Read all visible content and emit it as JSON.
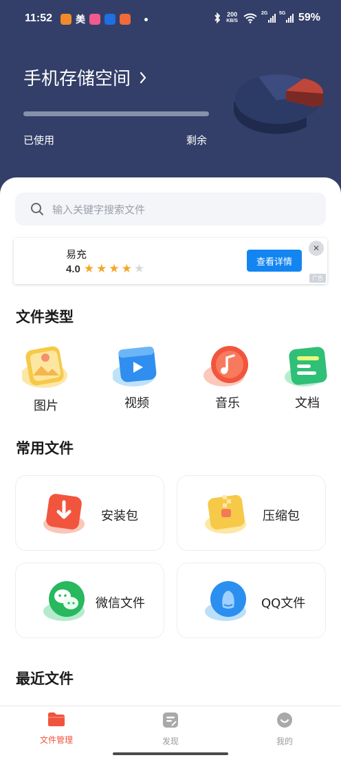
{
  "status_bar": {
    "time": "11:52",
    "mei_label": "美",
    "net_speed_value": "200",
    "net_speed_unit": "KB/S",
    "signal1_label": "2G",
    "signal2_label": "5G",
    "battery": "59%"
  },
  "storage": {
    "title": "手机存储空间",
    "used_label": "已使用",
    "free_label": "剩余",
    "used_fraction": 0.0
  },
  "search": {
    "placeholder": "输入关键字搜索文件"
  },
  "ad": {
    "app_name": "易充",
    "rating": "4.0",
    "stars_filled": 4,
    "stars_total": 5,
    "button_label": "查看详情",
    "badge": "广告"
  },
  "file_types": {
    "title": "文件类型",
    "items": [
      {
        "label": "图片",
        "icon": "image-icon"
      },
      {
        "label": "视频",
        "icon": "video-icon"
      },
      {
        "label": "音乐",
        "icon": "music-icon"
      },
      {
        "label": "文档",
        "icon": "document-icon"
      }
    ]
  },
  "common_files": {
    "title": "常用文件",
    "items": [
      {
        "label": "安装包",
        "icon": "apk-icon"
      },
      {
        "label": "压缩包",
        "icon": "zip-icon"
      },
      {
        "label": "微信文件",
        "icon": "wechat-icon"
      },
      {
        "label": "QQ文件",
        "icon": "qq-icon"
      }
    ]
  },
  "recent": {
    "title": "最近文件"
  },
  "bottom_nav": {
    "items": [
      {
        "label": "文件管理",
        "active": true
      },
      {
        "label": "发现",
        "active": false
      },
      {
        "label": "我的",
        "active": false
      }
    ]
  },
  "colors": {
    "header_bg": "#333f68",
    "accent": "#f0543c",
    "ad_button": "#1385f1",
    "star": "#f5a623"
  }
}
